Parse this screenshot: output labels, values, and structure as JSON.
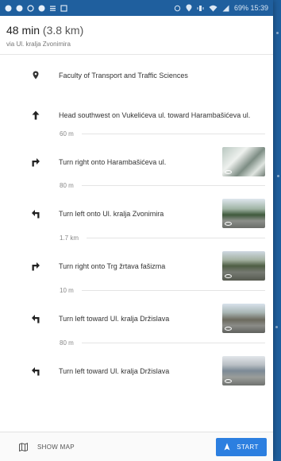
{
  "status": {
    "battery_text": "69% 15:39"
  },
  "header": {
    "eta": "48 min",
    "distance": "(3.8 km)",
    "via": "via Ul. kralja Zvonimira"
  },
  "steps": [
    {
      "icon": "place-pin-icon",
      "text": "Faculty of Transport and Traffic Sciences"
    },
    {
      "icon": "arrow-up-icon",
      "text": "Head southwest on Vukelićeva ul. toward Harambašićeva ul."
    },
    {
      "icon": "turn-right-icon",
      "text": "Turn right onto Harambašićeva ul."
    },
    {
      "icon": "turn-left-icon",
      "text": "Turn left onto Ul. kralja Zvonimira"
    },
    {
      "icon": "turn-right-icon",
      "text": "Turn right onto Trg žrtava fašizma"
    },
    {
      "icon": "turn-left-icon",
      "text": "Turn left toward Ul. kralja Držislava"
    },
    {
      "icon": "turn-left-icon",
      "text": "Turn left toward Ul. kralja Držislava"
    }
  ],
  "distances": [
    "60 m",
    "80 m",
    "1.7 km",
    "10 m",
    "80 m"
  ],
  "bottom": {
    "show_map": "SHOW MAP",
    "start": "START"
  },
  "colors": {
    "accent": "#2c7fe0",
    "status_bar": "#1f5f9e"
  }
}
